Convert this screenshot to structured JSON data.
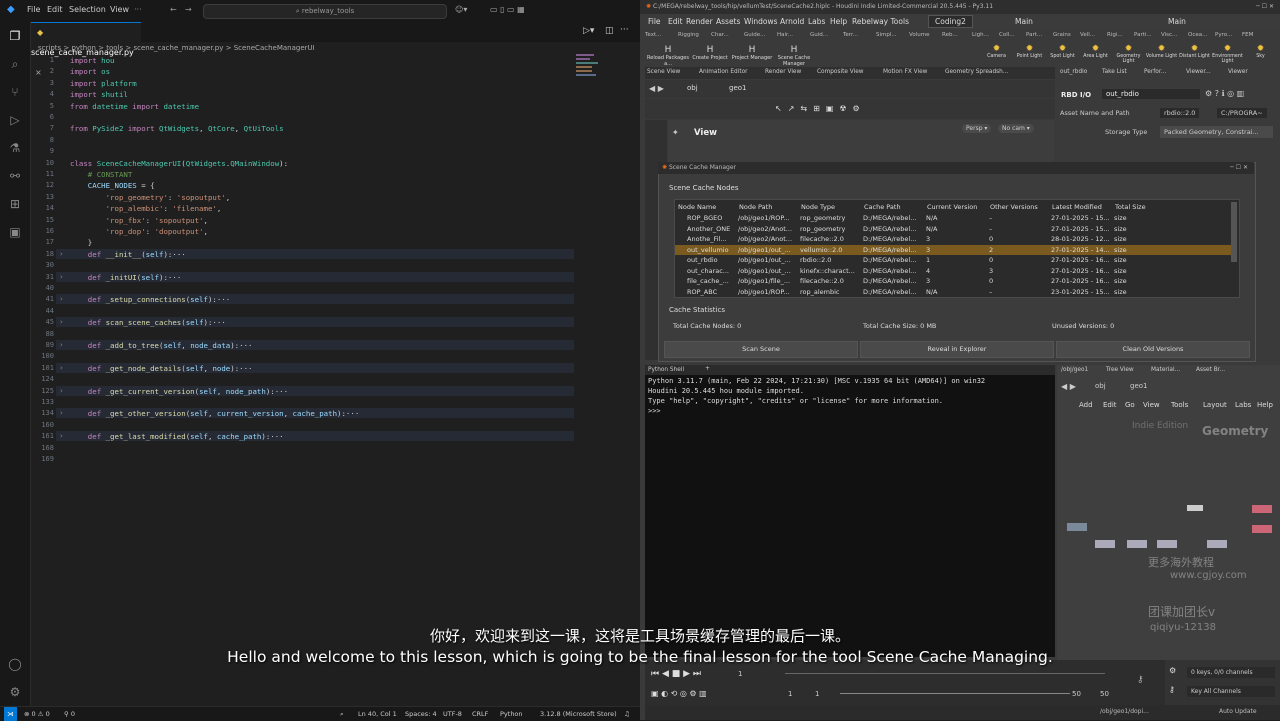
{
  "vscode": {
    "menu": [
      "File",
      "Edit",
      "Selection",
      "View"
    ],
    "search_placeholder": "rebelway_tools",
    "tab_label": "scene_cache_manager.py",
    "breadcrumb": "scripts > python > tools > scene_cache_manager.py > SceneCacheManagerUI",
    "code_lines": [
      {
        "n": "1",
        "parts": [
          [
            "kw",
            "import "
          ],
          [
            "cls",
            "hou"
          ]
        ]
      },
      {
        "n": "2",
        "parts": [
          [
            "kw",
            "import "
          ],
          [
            "cls",
            "os"
          ]
        ]
      },
      {
        "n": "3",
        "parts": [
          [
            "kw",
            "import "
          ],
          [
            "cls",
            "platform"
          ]
        ]
      },
      {
        "n": "4",
        "parts": [
          [
            "kw",
            "import "
          ],
          [
            "cls",
            "shutil"
          ]
        ]
      },
      {
        "n": "5",
        "parts": [
          [
            "kw",
            "from "
          ],
          [
            "cls",
            "datetime "
          ],
          [
            "kw",
            "import "
          ],
          [
            "cls",
            "datetime"
          ]
        ]
      },
      {
        "n": "6",
        "parts": []
      },
      {
        "n": "7",
        "parts": [
          [
            "kw",
            "from "
          ],
          [
            "cls",
            "PySide2 "
          ],
          [
            "kw",
            "import "
          ],
          [
            "cls",
            "QtWidgets"
          ],
          [
            "pl",
            ", "
          ],
          [
            "cls",
            "QtCore"
          ],
          [
            "pl",
            ", "
          ],
          [
            "cls",
            "QtUiTools"
          ]
        ]
      },
      {
        "n": "8",
        "parts": []
      },
      {
        "n": "9",
        "parts": []
      },
      {
        "n": "10",
        "parts": [
          [
            "kw",
            "class "
          ],
          [
            "cls",
            "SceneCacheManagerUI"
          ],
          [
            "pl",
            "("
          ],
          [
            "cls",
            "QtWidgets"
          ],
          [
            "pl",
            "."
          ],
          [
            "cls",
            "QMainWindow"
          ],
          [
            "pl",
            "):"
          ]
        ]
      },
      {
        "n": "11",
        "parts": [
          [
            "cm",
            "    # CONSTANT"
          ]
        ]
      },
      {
        "n": "12",
        "parts": [
          [
            "var",
            "    CACHE_NODES "
          ],
          [
            "pl",
            "= {"
          ]
        ]
      },
      {
        "n": "13",
        "parts": [
          [
            "str",
            "        'rop_geometry'"
          ],
          [
            "pl",
            ": "
          ],
          [
            "str",
            "'sopoutput'"
          ],
          [
            "pl",
            ","
          ]
        ]
      },
      {
        "n": "14",
        "parts": [
          [
            "str",
            "        'rop_alembic'"
          ],
          [
            "pl",
            ": "
          ],
          [
            "str",
            "'filename'"
          ],
          [
            "pl",
            ","
          ]
        ]
      },
      {
        "n": "15",
        "parts": [
          [
            "str",
            "        'rop_fbx'"
          ],
          [
            "pl",
            ": "
          ],
          [
            "str",
            "'sopoutput'"
          ],
          [
            "pl",
            ","
          ]
        ]
      },
      {
        "n": "16",
        "parts": [
          [
            "str",
            "        'rop_dop'"
          ],
          [
            "pl",
            ": "
          ],
          [
            "str",
            "'dopoutput'"
          ],
          [
            "pl",
            ","
          ]
        ]
      },
      {
        "n": "17",
        "parts": [
          [
            "pl",
            "    }"
          ]
        ]
      },
      {
        "n": "18",
        "parts": [
          [
            "kw",
            "    def "
          ],
          [
            "fn",
            "__init__"
          ],
          [
            "pl",
            "("
          ],
          [
            "var",
            "self"
          ],
          [
            "pl",
            "):···"
          ]
        ],
        "folded": true
      },
      {
        "n": "30",
        "parts": []
      },
      {
        "n": "31",
        "parts": [
          [
            "kw",
            "    def "
          ],
          [
            "fn",
            "_initUI"
          ],
          [
            "pl",
            "("
          ],
          [
            "var",
            "self"
          ],
          [
            "pl",
            "):···"
          ]
        ],
        "folded": true
      },
      {
        "n": "40",
        "parts": []
      },
      {
        "n": "41",
        "parts": [
          [
            "kw",
            "    def "
          ],
          [
            "fn",
            "_setup_connections"
          ],
          [
            "pl",
            "("
          ],
          [
            "var",
            "self"
          ],
          [
            "pl",
            "):···"
          ]
        ],
        "folded": true
      },
      {
        "n": "44",
        "parts": []
      },
      {
        "n": "45",
        "parts": [
          [
            "kw",
            "    def "
          ],
          [
            "fn",
            "scan_scene_caches"
          ],
          [
            "pl",
            "("
          ],
          [
            "var",
            "self"
          ],
          [
            "pl",
            "):···"
          ]
        ],
        "folded": true
      },
      {
        "n": "88",
        "parts": []
      },
      {
        "n": "89",
        "parts": [
          [
            "kw",
            "    def "
          ],
          [
            "fn",
            "_add_to_tree"
          ],
          [
            "pl",
            "("
          ],
          [
            "var",
            "self"
          ],
          [
            "pl",
            ", "
          ],
          [
            "var",
            "node_data"
          ],
          [
            "pl",
            "):···"
          ]
        ],
        "folded": true
      },
      {
        "n": "100",
        "parts": []
      },
      {
        "n": "101",
        "parts": [
          [
            "kw",
            "    def "
          ],
          [
            "fn",
            "_get_node_details"
          ],
          [
            "pl",
            "("
          ],
          [
            "var",
            "self"
          ],
          [
            "pl",
            ", "
          ],
          [
            "var",
            "node"
          ],
          [
            "pl",
            "):···"
          ]
        ],
        "folded": true
      },
      {
        "n": "124",
        "parts": []
      },
      {
        "n": "125",
        "parts": [
          [
            "kw",
            "    def "
          ],
          [
            "fn",
            "_get_current_version"
          ],
          [
            "pl",
            "("
          ],
          [
            "var",
            "self"
          ],
          [
            "pl",
            ", "
          ],
          [
            "var",
            "node_path"
          ],
          [
            "pl",
            "):···"
          ]
        ],
        "folded": true
      },
      {
        "n": "133",
        "parts": []
      },
      {
        "n": "134",
        "parts": [
          [
            "kw",
            "    def "
          ],
          [
            "fn",
            "_get_other_version"
          ],
          [
            "pl",
            "("
          ],
          [
            "var",
            "self"
          ],
          [
            "pl",
            ", "
          ],
          [
            "var",
            "current_version"
          ],
          [
            "pl",
            ", "
          ],
          [
            "var",
            "cache_path"
          ],
          [
            "pl",
            "):···"
          ]
        ],
        "folded": true
      },
      {
        "n": "160",
        "parts": []
      },
      {
        "n": "161",
        "parts": [
          [
            "kw",
            "    def "
          ],
          [
            "fn",
            "_get_last_modified"
          ],
          [
            "pl",
            "("
          ],
          [
            "var",
            "self"
          ],
          [
            "pl",
            ", "
          ],
          [
            "var",
            "cache_path"
          ],
          [
            "pl",
            "):···"
          ]
        ],
        "folded": true
      },
      {
        "n": "168",
        "parts": []
      },
      {
        "n": "169",
        "parts": []
      }
    ],
    "status": {
      "errors": "⊗ 0 ⚠ 0",
      "ports": "⚲ 0",
      "position": "Ln 40, Col 1",
      "spaces": "Spaces: 4",
      "encoding": "UTF-8",
      "eol": "CRLF",
      "language": "Python",
      "interpreter": "3.12.8 (Microsoft Store)"
    }
  },
  "houdini": {
    "title": "C:/MEGA/rebelway_tools/hip/vellumTest/SceneCache2.hiplc - Houdini Indie Limited-Commercial 20.5.445 - Py3.11",
    "menu": [
      "File",
      "Edit",
      "Render",
      "Assets",
      "Windows",
      "Arnold",
      "Labs",
      "Help",
      "Rebelway Tools"
    ],
    "desktop": "Coding2",
    "main": "Main",
    "shelf_tabs": [
      "Text...",
      "Rigging",
      "Char...",
      "Guide...",
      "Hair...",
      "Guid...",
      "Terr...",
      "Simpl...",
      "Volume",
      "Reb..."
    ],
    "shelf_buttons": [
      "Reload Packages a...",
      "Create Project",
      "Project Manager",
      "Scene Cache Manager"
    ],
    "right_shelf_tabs": [
      "Ligh...",
      "Coll...",
      "Part...",
      "Grains",
      "Vell...",
      "Rigi...",
      "Parti...",
      "Visc...",
      "Ocea...",
      "Pyro...",
      "FEM"
    ],
    "right_shelf_buttons": [
      "Camera",
      "Point Light",
      "Spot Light",
      "Area Light",
      "Geometry Light",
      "Volume Light",
      "Distant Light",
      "Environment Light",
      "Sky"
    ],
    "pane_tabs": [
      "Scene View",
      "Animation Editor",
      "Render View",
      "Composite View",
      "Motion FX View",
      "Geometry Spreadsh..."
    ],
    "path_obj": "obj",
    "path_geo": "geo1",
    "view_label": "View",
    "persp": "Persp ▾",
    "nocam": "No cam ▾",
    "params_tabs": [
      "out_rbdio",
      "Take List",
      "Perfor...",
      "Viewer...",
      "Viewer"
    ],
    "node_type": "RBD I/O",
    "node_name": "out_rbdio",
    "asset_label": "Asset Name and Path",
    "asset_value": "rbdio::2.0",
    "asset_path": "C:/PROGRA~",
    "storage_label": "Storage Type",
    "storage_value": "Packed Geometry, Constrai...",
    "scm": {
      "title": "Scene Cache Manager",
      "nodes_label": "Scene Cache Nodes",
      "columns": [
        "Node Name",
        "Node Path",
        "Node Type",
        "Cache Path",
        "Current Version",
        "Other Versions",
        "Latest Modified",
        "Total Size"
      ],
      "rows": [
        [
          "ROP_BGEO",
          "/obj/geo1/ROP...",
          "rop_geometry",
          "D:/MEGA/rebel...",
          "N/A",
          "–",
          "27-01-2025 - 15...",
          "size"
        ],
        [
          "Another_ONE",
          "/obj/geo2/Anot...",
          "rop_geometry",
          "D:/MEGA/rebel...",
          "N/A",
          "–",
          "27-01-2025 - 15...",
          "size"
        ],
        [
          "Anothe_Fil...",
          "/obj/geo2/Anot...",
          "filecache::2.0",
          "D:/MEGA/rebel...",
          "3",
          "0",
          "28-01-2025 - 12...",
          "size"
        ],
        [
          "out_vellumio",
          "/obj/geo1/out_...",
          "vellumio::2.0",
          "D:/MEGA/rebel...",
          "3",
          "2",
          "27-01-2025 - 14...",
          "size"
        ],
        [
          "out_rbdio",
          "/obj/geo1/out_...",
          "rbdio::2.0",
          "D:/MEGA/rebel...",
          "1",
          "0",
          "27-01-2025 - 16...",
          "size"
        ],
        [
          "out_charac...",
          "/obj/geo1/out_...",
          "kinefx::charact...",
          "D:/MEGA/rebel...",
          "4",
          "3",
          "27-01-2025 - 16...",
          "size"
        ],
        [
          "file_cache_...",
          "/obj/geo1/file_...",
          "filecache::2.0",
          "D:/MEGA/rebel...",
          "3",
          "0",
          "27-01-2025 - 16...",
          "size"
        ],
        [
          "ROP_ABC",
          "/obj/geo1/ROP...",
          "rop_alembic",
          "D:/MEGA/rebel...",
          "N/A",
          "–",
          "23-01-2025 - 15...",
          "size"
        ]
      ],
      "selected_row": 3,
      "stats_label": "Cache Statistics",
      "total_nodes": "Total Cache Nodes: 0",
      "total_size": "Total Cache Size: 0 MB",
      "unused": "Unused Versions: 0",
      "btn_scan": "Scan Scene",
      "btn_reveal": "Reveal in Explorer",
      "btn_clean": "Clean Old Versions"
    },
    "shell_tab": "Python Shell",
    "shell_lines": [
      "Python 3.11.7 (main, Feb 22 2024, 17:21:30) [MSC v.1935 64 bit (AMD64)] on win32",
      "Houdini 20.5.445 hou module imported.",
      "Type \"help\", \"copyright\", \"credits\" or \"license\" for more information.",
      ">>>"
    ],
    "net_tabs": [
      "/obj/geo1",
      "Tree View",
      "Material...",
      "Asset Br..."
    ],
    "net_menu": [
      "Add",
      "Edit",
      "Go",
      "View",
      "Tools",
      "Layout",
      "Labs",
      "Help"
    ],
    "net_watermark": "Indie Edition",
    "net_context": "Geometry",
    "frame_current": "1",
    "frame_start": "1",
    "frame_end": "50",
    "frame_end2": "50",
    "keys": "0 keys, 0/0 channels",
    "key_all": "Key All Channels",
    "status_path": "/obj/geo1/dopi...",
    "auto_update": "Auto Update"
  },
  "subtitle": {
    "cn": "你好，欢迎来到这一课，这将是工具场景缓存管理的最后一课。",
    "en": "Hello and welcome to this lesson, which is going to be the final lesson for the tool Scene Cache Managing."
  },
  "watermark": {
    "line1": "更多海外教程",
    "line2": "www.cgjoy.com",
    "line3": "团课加团长v",
    "line4": "qiqiyu-12138"
  },
  "colors": {
    "accent": "#0078d4",
    "selected_row": "#7a5a1e",
    "houdini_bg": "#3a3a3a"
  }
}
